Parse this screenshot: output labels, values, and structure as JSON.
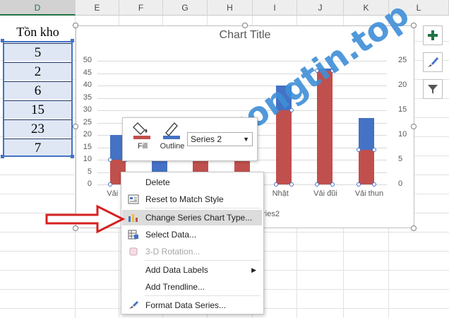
{
  "columns": [
    "D",
    "E",
    "F",
    "G",
    "H",
    "I",
    "J",
    "K",
    "L"
  ],
  "selected_column": "D",
  "cells": {
    "header": "Tồn kho",
    "values": [
      "5",
      "2",
      "6",
      "15",
      "23",
      "7"
    ]
  },
  "chart": {
    "title": "Chart Title",
    "left_ticks": [
      "50",
      "45",
      "40",
      "35",
      "30",
      "25",
      "20",
      "15",
      "10",
      "5",
      "0"
    ],
    "right_ticks": [
      "25",
      "20",
      "15",
      "10",
      "5",
      "0"
    ],
    "x_labels": [
      "Vải",
      "Nhật",
      "Vải đũi",
      "Vải thun"
    ],
    "legend_fragment": "eries2"
  },
  "chart_data": {
    "type": "bar",
    "categories": [
      "Vải …",
      "",
      "",
      "",
      "Nhật",
      "Vải đũi",
      "Vải thun"
    ],
    "series": [
      {
        "name": "",
        "values": [
          20,
          10,
          10,
          10,
          40,
          47,
          27
        ]
      },
      {
        "name": "Series2",
        "values": [
          5,
          2,
          6,
          10,
          15,
          23,
          7
        ]
      }
    ],
    "ylim": [
      0,
      50
    ],
    "y2lim": [
      0,
      25
    ]
  },
  "mini_toolbar": {
    "fill_label": "Fill",
    "outline_label": "Outline",
    "series_select": "Series 2"
  },
  "context_menu": {
    "items": [
      {
        "label": "Delete",
        "icon": "delete-icon",
        "disabled": false
      },
      {
        "label": "Reset to Match Style",
        "icon": "reset-style-icon",
        "disabled": false
      },
      {
        "label": "Change Series Chart Type...",
        "icon": "chart-type-icon",
        "disabled": false,
        "highlighted": true
      },
      {
        "label": "Select Data...",
        "icon": "select-data-icon",
        "disabled": false
      },
      {
        "label": "3-D Rotation...",
        "icon": "rotation-3d-icon",
        "disabled": true
      },
      {
        "label": "Add Data Labels",
        "icon": "",
        "disabled": false,
        "submenu": true
      },
      {
        "label": "Add Trendline...",
        "icon": "",
        "disabled": false
      },
      {
        "label": "Format Data Series...",
        "icon": "format-series-icon",
        "disabled": false
      }
    ]
  },
  "side_buttons": [
    "chart-elements-icon",
    "chart-styles-icon",
    "chart-filters-icon"
  ],
  "watermark": "Truongtin.top",
  "colors": {
    "blue": "#4472c4",
    "red": "#c0504d",
    "excel_green": "#217346",
    "arrow": "#d62020"
  }
}
